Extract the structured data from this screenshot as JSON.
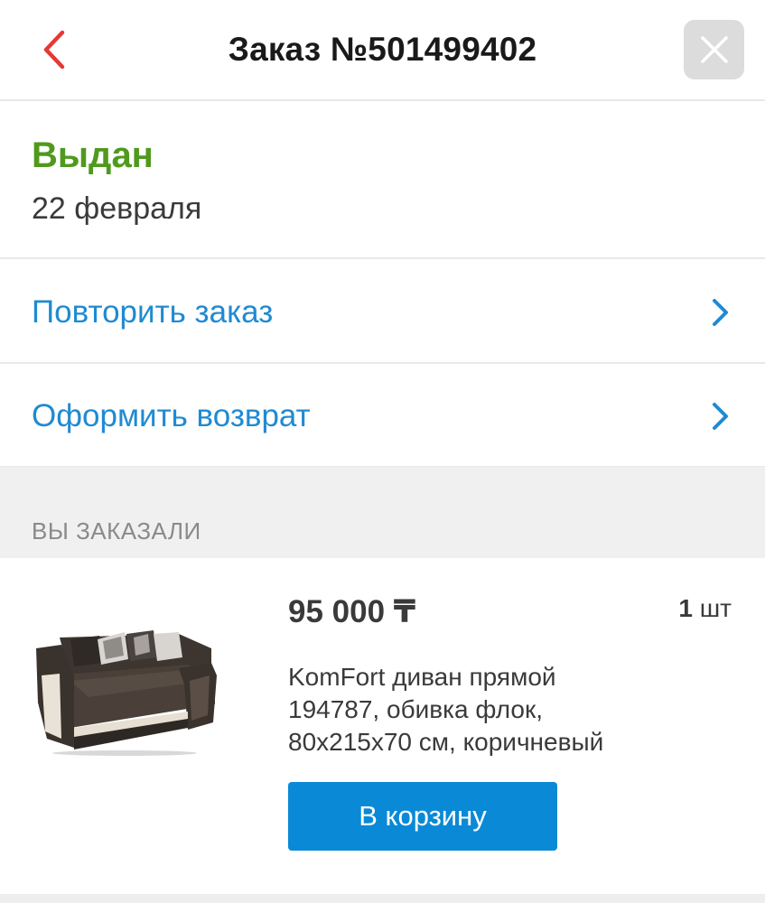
{
  "header": {
    "title": "Заказ №501499402",
    "back_icon": "chevron-left-icon",
    "close_icon": "close-icon",
    "accent_color": "#e53935"
  },
  "status": {
    "label": "Выдан",
    "date": "22 февраля",
    "color": "#4f9a1d"
  },
  "actions": [
    {
      "label": "Повторить заказ",
      "icon": "chevron-right-icon"
    },
    {
      "label": "Оформить возврат",
      "icon": "chevron-right-icon"
    }
  ],
  "ordered_section": {
    "title": "ВЫ ЗАКАЗАЛИ"
  },
  "item": {
    "price": "95 000 ₸",
    "qty_number": "1",
    "qty_unit": "шт",
    "name_lines": [
      "KomFort диван прямой",
      "194787, обивка флок,",
      "80x215x70 см, коричневый"
    ],
    "add_to_cart_label": "В корзину",
    "button_color": "#0a8ad6"
  }
}
